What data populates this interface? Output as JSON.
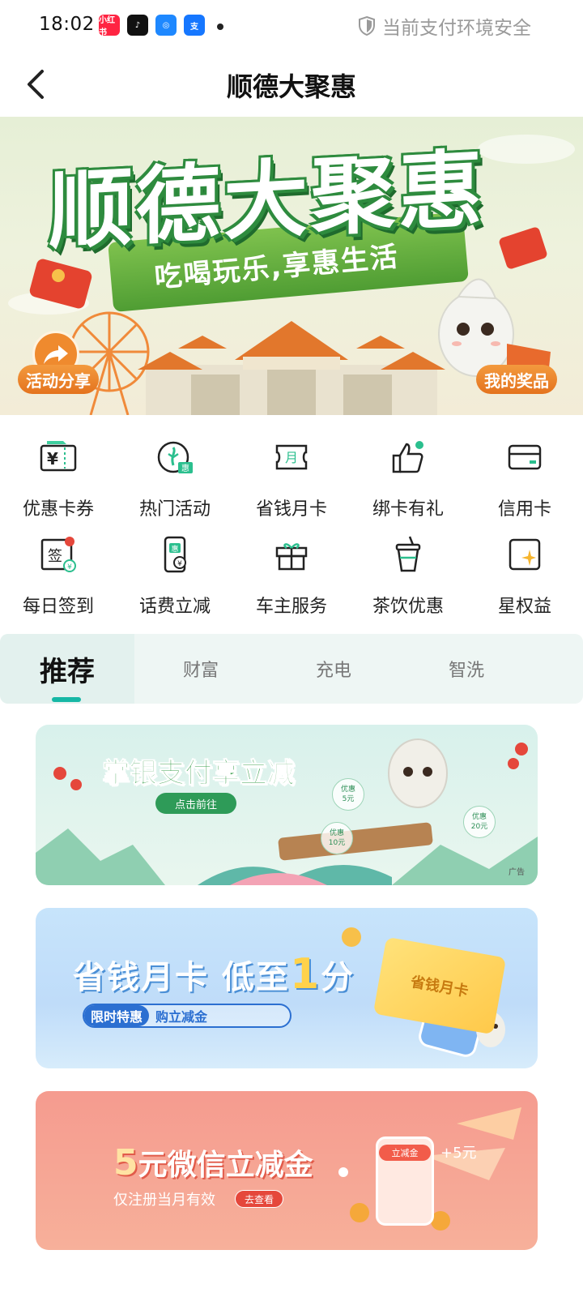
{
  "status_bar": {
    "time": "18:02",
    "app_icons": [
      {
        "name": "xiaohongshu-app-icon",
        "label": "小红书",
        "color": "#ff2442"
      },
      {
        "name": "douyin-app-icon",
        "label": "♪",
        "color": "#111111"
      },
      {
        "name": "blue-app-icon",
        "label": "◎",
        "color": "#1677ff"
      },
      {
        "name": "alipay-app-icon",
        "label": "支",
        "color": "#1677ff"
      }
    ],
    "security_text": "当前支付环境安全"
  },
  "header": {
    "title": "顺德大聚惠"
  },
  "hero": {
    "title": "顺德大聚惠",
    "subtitle": "吃喝玩乐,享惠生活",
    "share_label": "活动分享",
    "prize_label": "我的奖品"
  },
  "grid": {
    "items": [
      {
        "label": "优惠卡券",
        "icon": "coupon-ticket-icon"
      },
      {
        "label": "热门活动",
        "icon": "hot-activity-icon"
      },
      {
        "label": "省钱月卡",
        "icon": "monthly-card-icon"
      },
      {
        "label": "绑卡有礼",
        "icon": "thumbs-up-icon"
      },
      {
        "label": "信用卡",
        "icon": "credit-card-icon"
      },
      {
        "label": "每日签到",
        "icon": "checkin-icon"
      },
      {
        "label": "话费立减",
        "icon": "phone-bill-icon"
      },
      {
        "label": "车主服务",
        "icon": "gift-box-icon"
      },
      {
        "label": "茶饮优惠",
        "icon": "tea-cup-icon"
      },
      {
        "label": "星权益",
        "icon": "star-rights-icon"
      }
    ]
  },
  "tabs": [
    {
      "label": "推荐",
      "active": true
    },
    {
      "label": "财富",
      "active": false
    },
    {
      "label": "充电",
      "active": false
    },
    {
      "label": "智洗",
      "active": false
    }
  ],
  "banners": {
    "b1": {
      "title": "掌银支付享立减",
      "button": "点击前往",
      "coupons": [
        "优惠\n5元",
        "优惠\n10元",
        "优惠\n20元"
      ],
      "ad": "广告"
    },
    "b2": {
      "title_part1": "省钱月卡 低至",
      "title_accent": "1",
      "title_part2": "分",
      "tag": "限时特惠",
      "tag_text": "购立减金",
      "card_text": "省钱月卡"
    },
    "b3": {
      "title_num": "5",
      "title_rest": "元微信立减金",
      "sub": "仅注册当月有效",
      "button": "去查看",
      "badge": "立减金",
      "plus": "+5元"
    }
  },
  "colors": {
    "accent": "#16b7a5",
    "hero_green": "#2e8b3e",
    "pill_orange": "#e4731e"
  }
}
